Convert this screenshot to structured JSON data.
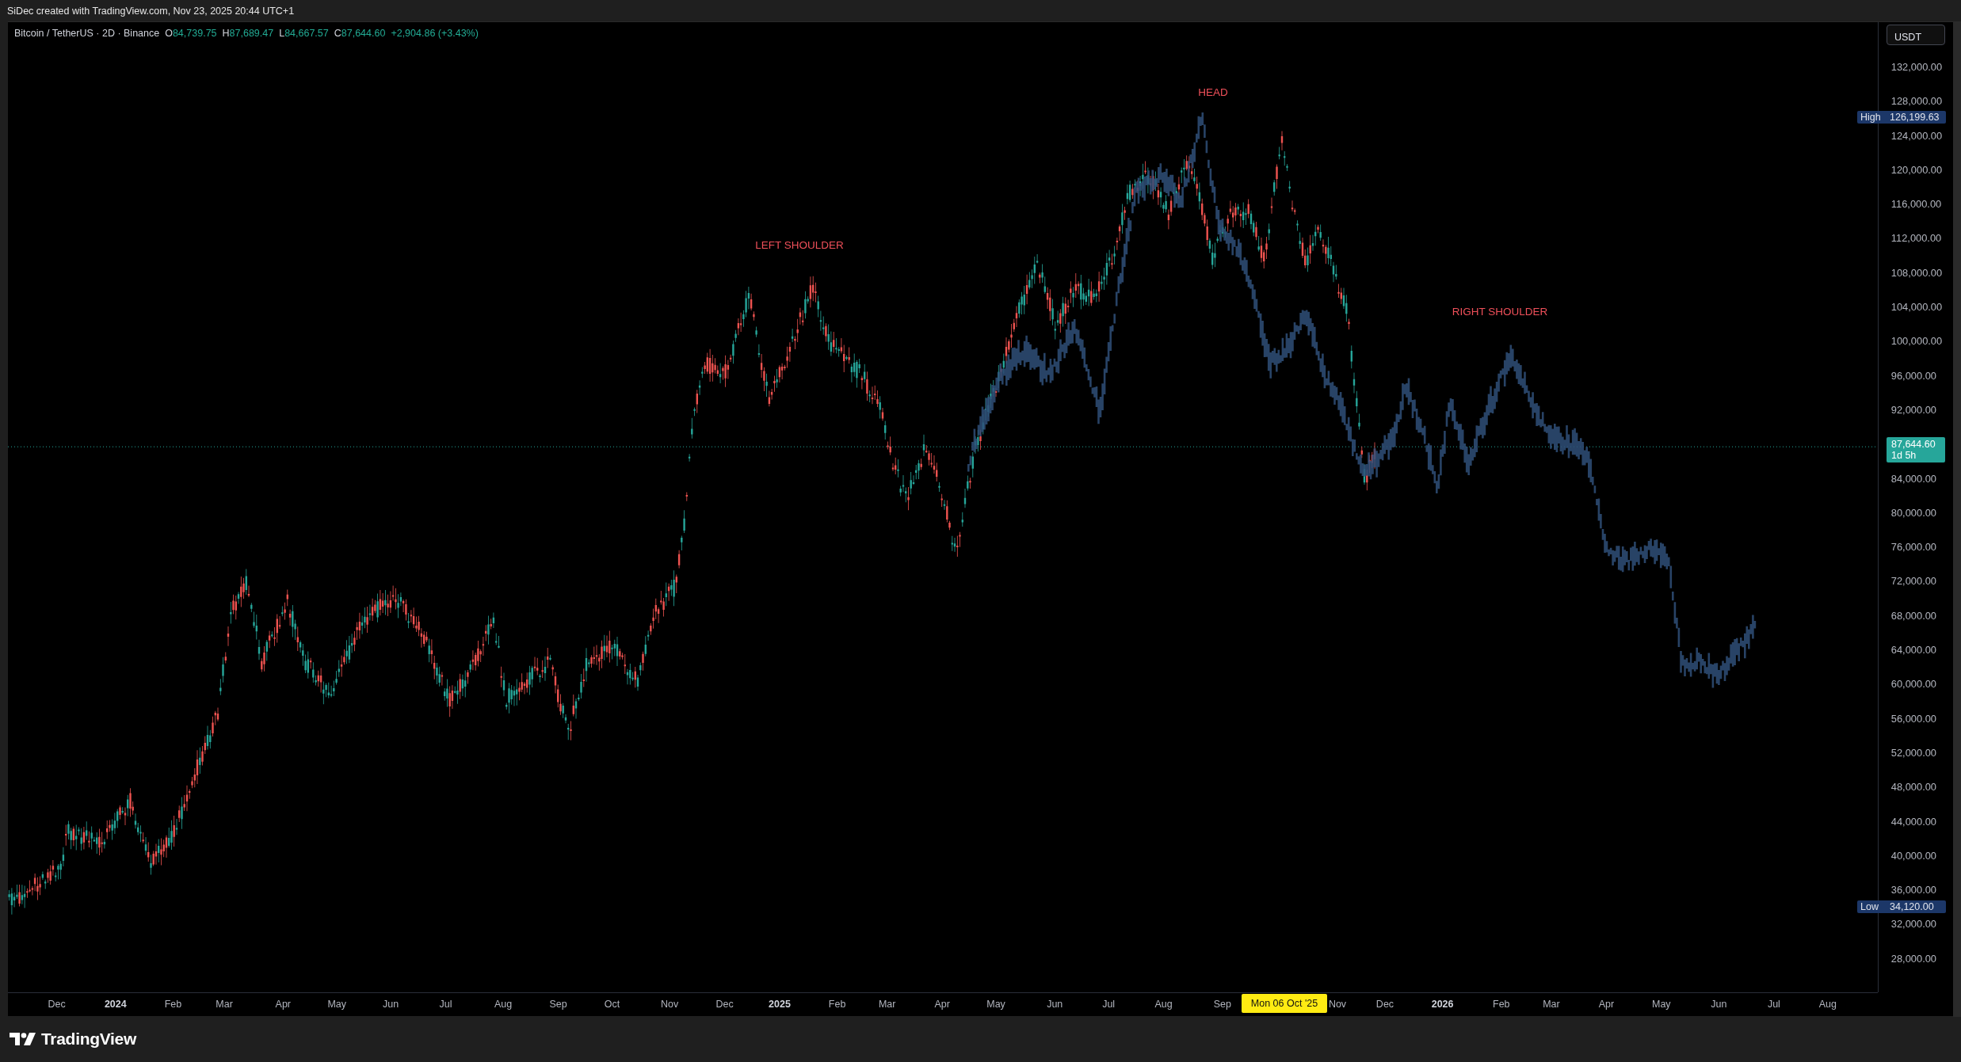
{
  "header": {
    "text": "SiDec created with TradingView.com, Nov 23, 2025 20:44 UTC+1"
  },
  "legend": {
    "symbol": "Bitcoin / TetherUS · 2D · Binance",
    "ohlc": [
      {
        "label": "O",
        "value": "84,739.75"
      },
      {
        "label": "H",
        "value": "87,689.47"
      },
      {
        "label": "L",
        "value": "84,667.57"
      },
      {
        "label": "C",
        "value": "87,644.60"
      }
    ],
    "change": "+2,904.86 (+3.43%)"
  },
  "currency_button": "USDT",
  "price_axis": {
    "labels": [
      "132,000.00",
      "128,000.00",
      "124,000.00",
      "120,000.00",
      "116,000.00",
      "112,000.00",
      "108,000.00",
      "104,000.00",
      "100,000.00",
      "96,000.00",
      "92,000.00",
      "84,000.00",
      "80,000.00",
      "76,000.00",
      "72,000.00",
      "68,000.00",
      "64,000.00",
      "60,000.00",
      "56,000.00",
      "52,000.00",
      "48,000.00",
      "44,000.00",
      "40,000.00",
      "36,000.00",
      "32,000.00",
      "28,000.00"
    ]
  },
  "high_marker": {
    "label": "High",
    "value": "126,199.63"
  },
  "low_marker": {
    "label": "Low",
    "value": "34,120.00"
  },
  "last_price": {
    "value": "87,644.60",
    "countdown": "1d 5h"
  },
  "annotations": [
    {
      "text": "LEFT SHOULDER"
    },
    {
      "text": "HEAD"
    },
    {
      "text": "RIGHT SHOULDER"
    }
  ],
  "time_axis": {
    "labels": [
      {
        "text": "Dec",
        "kind": "month"
      },
      {
        "text": "2024",
        "kind": "year"
      },
      {
        "text": "Feb",
        "kind": "month"
      },
      {
        "text": "Mar",
        "kind": "month"
      },
      {
        "text": "Apr",
        "kind": "month"
      },
      {
        "text": "May",
        "kind": "month"
      },
      {
        "text": "Jun",
        "kind": "month"
      },
      {
        "text": "Jul",
        "kind": "month"
      },
      {
        "text": "Aug",
        "kind": "month"
      },
      {
        "text": "Sep",
        "kind": "month"
      },
      {
        "text": "Oct",
        "kind": "month"
      },
      {
        "text": "Nov",
        "kind": "month"
      },
      {
        "text": "Dec",
        "kind": "month"
      },
      {
        "text": "2025",
        "kind": "year"
      },
      {
        "text": "Feb",
        "kind": "month"
      },
      {
        "text": "Mar",
        "kind": "month"
      },
      {
        "text": "Apr",
        "kind": "month"
      },
      {
        "text": "May",
        "kind": "month"
      },
      {
        "text": "Jun",
        "kind": "month"
      },
      {
        "text": "Jul",
        "kind": "month"
      },
      {
        "text": "Aug",
        "kind": "month"
      },
      {
        "text": "Sep",
        "kind": "month"
      },
      {
        "text": "Nov",
        "kind": "month"
      },
      {
        "text": "Dec",
        "kind": "month"
      },
      {
        "text": "2026",
        "kind": "year"
      },
      {
        "text": "Feb",
        "kind": "month"
      },
      {
        "text": "Mar",
        "kind": "month"
      },
      {
        "text": "Apr",
        "kind": "month"
      },
      {
        "text": "May",
        "kind": "month"
      },
      {
        "text": "Jun",
        "kind": "month"
      },
      {
        "text": "Jul",
        "kind": "month"
      },
      {
        "text": "Aug",
        "kind": "month"
      }
    ]
  },
  "crosshair_date": "Mon 06 Oct '25",
  "footer": {
    "brand": "TradingView"
  }
}
